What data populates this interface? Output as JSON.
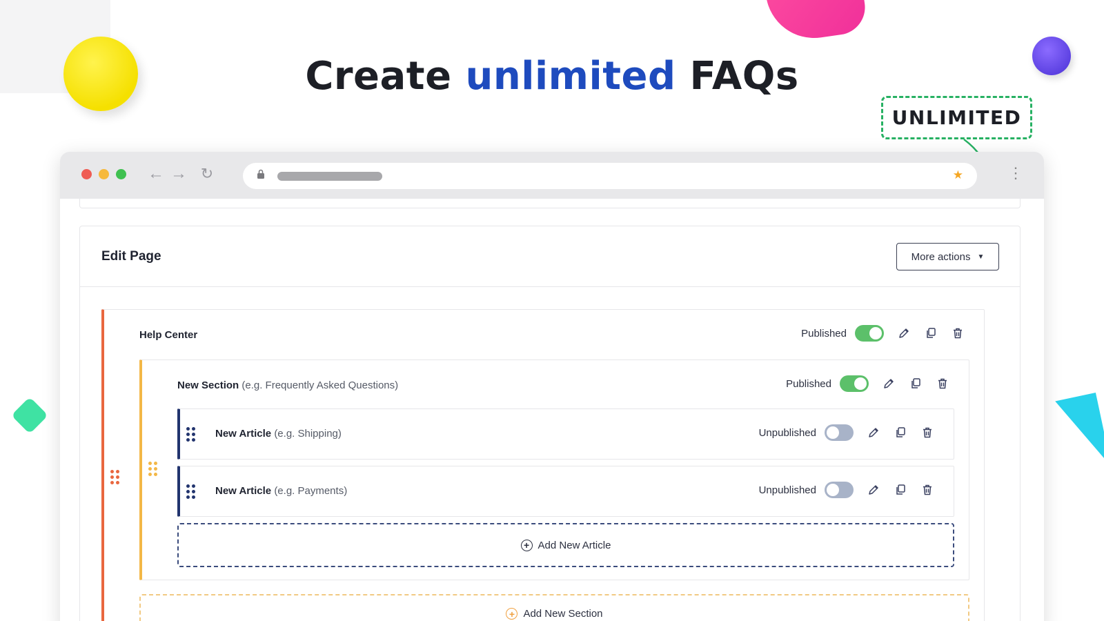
{
  "headline": {
    "prefix": "Create ",
    "accent": "unlimited",
    "suffix": " FAQs"
  },
  "badge": {
    "label": "UNLIMITED"
  },
  "colors": {
    "accent_blue": "#1e4bbe",
    "badge_green": "#27b163",
    "help_center_bar": "#e9673f",
    "section_bar": "#f3b746",
    "article_bar": "#22346e",
    "toggle_on": "#5cc06a",
    "toggle_off": "#a8b3c8"
  },
  "browser": {
    "nav": {
      "back_icon": "arrow-left-icon",
      "forward_icon": "arrow-right-icon",
      "reload_icon": "reload-icon"
    },
    "url_bar": {
      "lock_icon": "lock-icon",
      "star_icon": "star-icon"
    },
    "menu_icon": "kebab-menu-icon"
  },
  "edit_page": {
    "title": "Edit Page",
    "more_actions_label": "More actions"
  },
  "help_center": {
    "title": "Help Center",
    "status": "Published",
    "published": true,
    "section": {
      "title": "New Section",
      "hint": "(e.g. Frequently Asked Questions)",
      "status": "Published",
      "published": true,
      "articles": [
        {
          "title": "New Article",
          "hint": "(e.g. Shipping)",
          "status": "Unpublished",
          "published": false
        },
        {
          "title": "New Article",
          "hint": "(e.g. Payments)",
          "status": "Unpublished",
          "published": false
        }
      ],
      "add_article_label": "Add New Article"
    },
    "add_section_label": "Add New Section"
  }
}
